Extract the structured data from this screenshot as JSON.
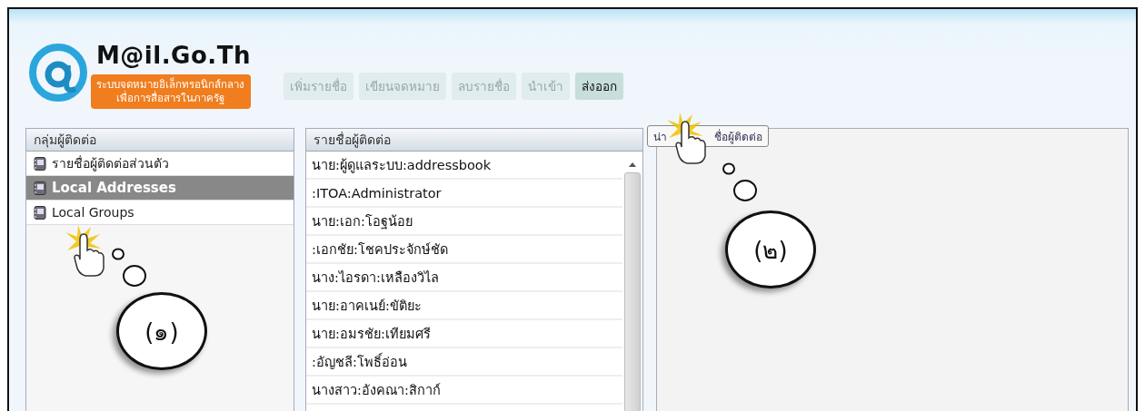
{
  "logo": {
    "title": "M@il.Go.Th",
    "tagline_lines": [
      "ระบบจดหมายอิเล็กทรอนิกส์กลาง",
      "เพื่อการสื่อสารในภาครัฐ"
    ]
  },
  "toolbar": [
    {
      "label": "เพิ่มรายชื่อ",
      "disabled": true
    },
    {
      "label": "เขียนจดหมาย",
      "disabled": true
    },
    {
      "label": "ลบรายชื่อ",
      "disabled": true
    },
    {
      "label": "นำเข้า",
      "disabled": true
    },
    {
      "label": "ส่งออก",
      "disabled": false
    }
  ],
  "tooltip": {
    "parts": [
      "น่า",
      "ชื่อผู้ติดต่อ"
    ]
  },
  "groups_panel": {
    "title": "กลุ่มผู้ติดต่อ",
    "items": [
      {
        "label": "รายชื่อผู้ติดต่อส่วนตัว",
        "selected": false
      },
      {
        "label": "Local Addresses",
        "selected": true
      },
      {
        "label": "Local Groups",
        "selected": false
      }
    ]
  },
  "contacts_panel": {
    "title": "รายชื่อผู้ติดต่อ",
    "items": [
      "นาย:ผู้ดูแลระบบ:addressbook",
      ":ITOA:Administrator",
      "นาย:เอก:โอฐน้อย",
      ":เอกชัย:โชคประจักษ์ชัด",
      "นาง:ไอรดา:เหลืองวิไล",
      "นาย:อาคเนย์:ขัติยะ",
      "นาย:อมรชัย:เทียมศรี",
      ":อัญชลี:โพธิ์อ่อน",
      "นางสาว:อังคณา:สิกาก์"
    ]
  },
  "callouts": [
    {
      "label": "(๑)"
    },
    {
      "label": "(๒)"
    }
  ]
}
